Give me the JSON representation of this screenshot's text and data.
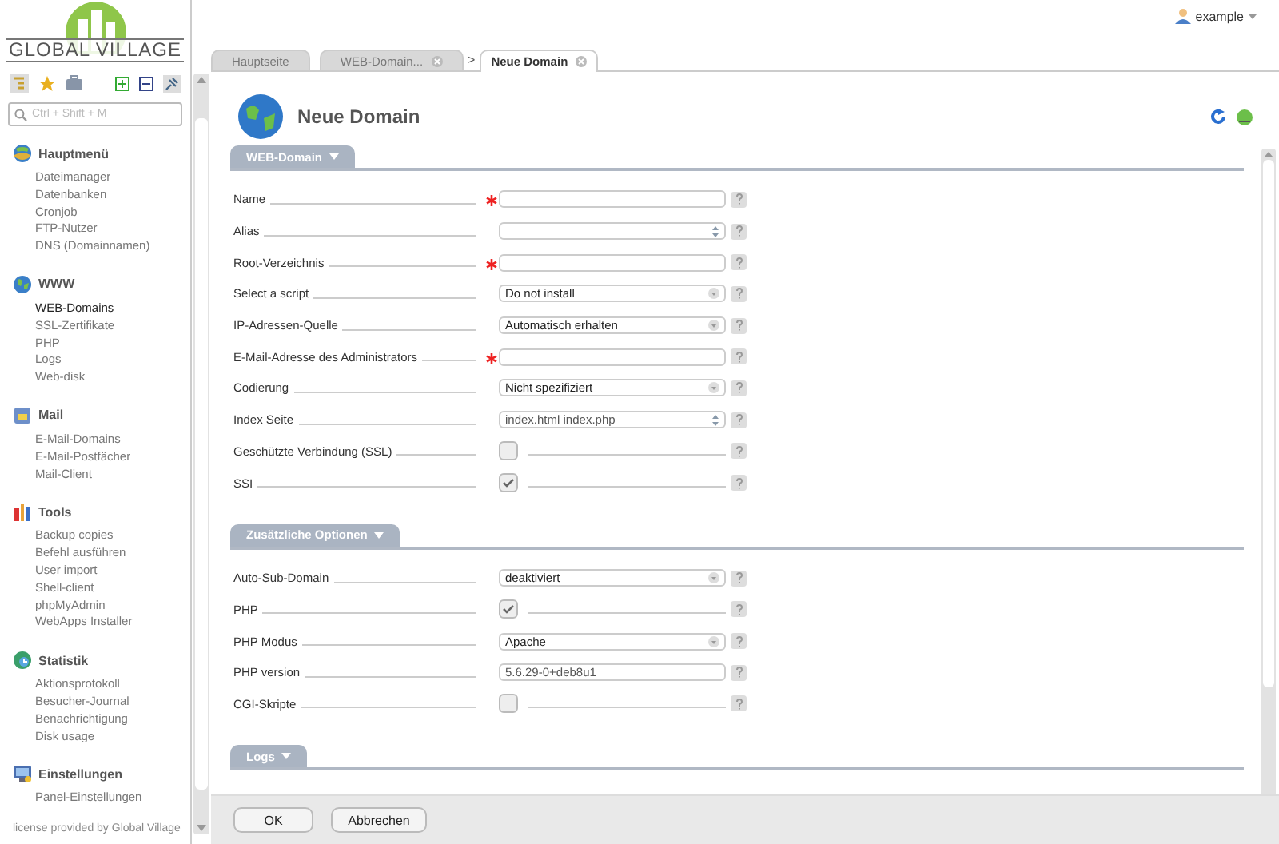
{
  "logo": {
    "text": "GLOBAL VILLAGE"
  },
  "user": {
    "name": "example"
  },
  "search": {
    "placeholder": "Ctrl + Shift + M"
  },
  "sidebar": {
    "groups": [
      {
        "title": "Hauptmenü",
        "items": [
          {
            "label": "Dateimanager",
            "selected": false
          },
          {
            "label": "Datenbanken",
            "selected": false
          },
          {
            "label": "Cronjob",
            "selected": false
          },
          {
            "label": "FTP-Nutzer",
            "selected": false
          },
          {
            "label": "DNS (Domainnamen)",
            "selected": false
          }
        ]
      },
      {
        "title": "WWW",
        "items": [
          {
            "label": "WEB-Domains",
            "selected": true
          },
          {
            "label": "SSL-Zertifikate",
            "selected": false
          },
          {
            "label": "PHP",
            "selected": false
          },
          {
            "label": "Logs",
            "selected": false
          },
          {
            "label": "Web-disk",
            "selected": false
          }
        ]
      },
      {
        "title": "Mail",
        "items": [
          {
            "label": "E-Mail-Domains",
            "selected": false
          },
          {
            "label": "E-Mail-Postfächer",
            "selected": false
          },
          {
            "label": "Mail-Client",
            "selected": false
          }
        ]
      },
      {
        "title": "Tools",
        "items": [
          {
            "label": "Backup copies",
            "selected": false
          },
          {
            "label": "Befehl ausführen",
            "selected": false
          },
          {
            "label": "User import",
            "selected": false
          },
          {
            "label": "Shell-client",
            "selected": false
          },
          {
            "label": "phpMyAdmin",
            "selected": false
          },
          {
            "label": "WebApps Installer",
            "selected": false
          }
        ]
      },
      {
        "title": "Statistik",
        "items": [
          {
            "label": "Aktionsprotokoll",
            "selected": false
          },
          {
            "label": "Besucher-Journal",
            "selected": false
          },
          {
            "label": "Benachrichtigung",
            "selected": false
          },
          {
            "label": "Disk usage",
            "selected": false
          }
        ]
      },
      {
        "title": "Einstellungen",
        "items": [
          {
            "label": "Panel-Einstellungen",
            "selected": false
          }
        ]
      }
    ],
    "footer": "license provided by Global Village"
  },
  "tabs": [
    {
      "kind": "tab",
      "label": "Hauptseite",
      "selected": false,
      "closable": false
    },
    {
      "kind": "tab",
      "label": "WEB-Domain...",
      "selected": false,
      "closable": true
    },
    {
      "kind": "separator",
      "label": ">"
    },
    {
      "kind": "tab",
      "label": "Neue Domain",
      "selected": true,
      "closable": true
    }
  ],
  "page": {
    "title": "Neue Domain"
  },
  "sections": [
    {
      "title": "WEB-Domain",
      "fields": [
        {
          "kind": "text",
          "label": "Name",
          "required": true
        },
        {
          "kind": "spin",
          "label": "Alias",
          "required": false
        },
        {
          "kind": "text",
          "label": "Root-Verzeichnis",
          "required": true
        },
        {
          "kind": "select",
          "label": "Select a script",
          "required": false,
          "value": "Do not install"
        },
        {
          "kind": "select",
          "label": "IP-Adressen-Quelle",
          "required": false,
          "value": "Automatisch erhalten"
        },
        {
          "kind": "text",
          "label": "E-Mail-Adresse des Administrators",
          "required": true
        },
        {
          "kind": "select",
          "label": "Codierung",
          "required": false,
          "value": "Nicht spezifiziert"
        },
        {
          "kind": "spin",
          "label": "Index Seite",
          "required": false,
          "value": "index.html index.php"
        },
        {
          "kind": "checkbox",
          "label": "Geschützte Verbindung (SSL)",
          "required": false,
          "checked": false
        },
        {
          "kind": "checkbox",
          "label": "SSI",
          "required": false,
          "checked": true
        }
      ]
    },
    {
      "title": "Zusätzliche Optionen",
      "fields": [
        {
          "kind": "select",
          "label": "Auto-Sub-Domain",
          "required": false,
          "value": "deaktiviert"
        },
        {
          "kind": "checkbox",
          "label": "PHP",
          "required": false,
          "checked": true
        },
        {
          "kind": "select",
          "label": "PHP Modus",
          "required": false,
          "value": "Apache"
        },
        {
          "kind": "text",
          "label": "PHP version",
          "required": false,
          "value": "5.6.29-0+deb8u1"
        },
        {
          "kind": "checkbox",
          "label": "CGI-Skripte",
          "required": false,
          "checked": false
        }
      ]
    },
    {
      "title": "Logs"
    }
  ],
  "buttons": [
    {
      "label": "OK"
    },
    {
      "label": "Abbrechen"
    }
  ]
}
